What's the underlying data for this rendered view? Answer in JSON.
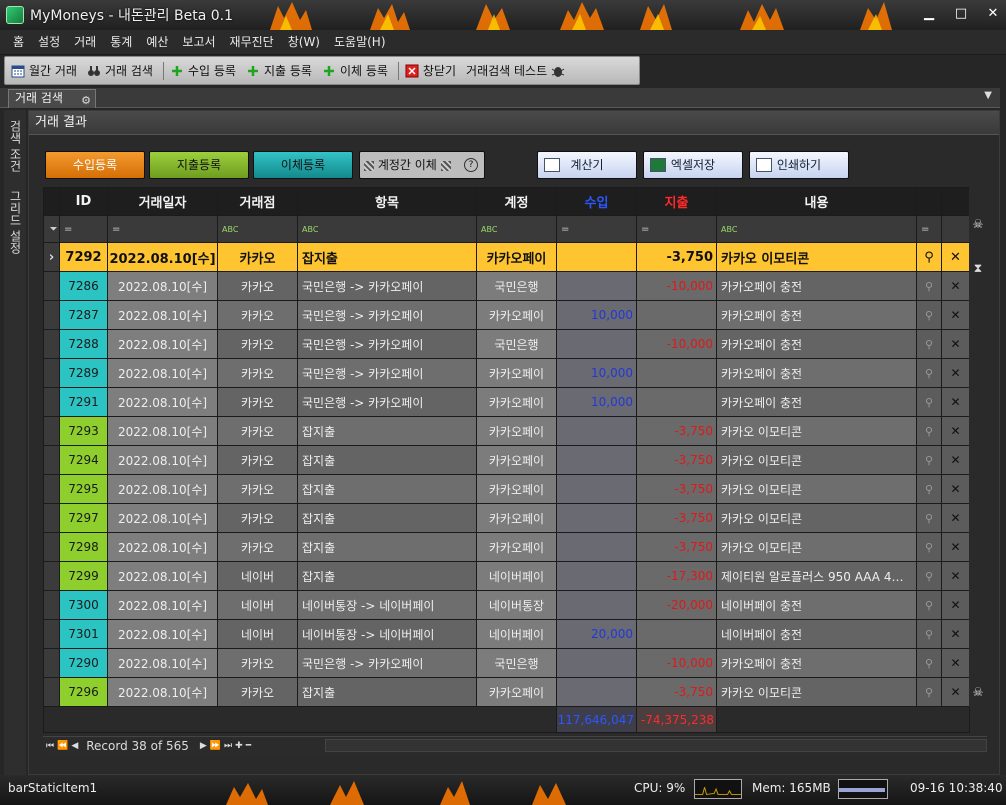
{
  "window": {
    "title": "MyMoneys - 내돈관리 Beta 0.1",
    "min": "▁",
    "max": "□",
    "close": "✕"
  },
  "menu": [
    "홈",
    "설정",
    "거래",
    "통계",
    "예산",
    "보고서",
    "재무진단",
    "창(W)",
    "도움말(H)"
  ],
  "toolbar": {
    "monthly": "월간 거래",
    "search": "거래 검색",
    "add_income": "수입 등록",
    "add_expense": "지출 등록",
    "add_transfer": "이체 등록",
    "close_window": "창닫기",
    "test": "거래검색 테스트"
  },
  "doc_tab": {
    "label": "거래 검색",
    "dropdown": "▼"
  },
  "side_tabs": [
    "검색 조건",
    "그리드 설정"
  ],
  "panel_title": "거래 결과",
  "buttons": {
    "income": "수입등록",
    "expense": "지출등록",
    "transfer": "이체등록",
    "between": "계정간 이체",
    "help": "?",
    "calc": "계산기",
    "excel": "엑셀저장",
    "print": "인쇄하기"
  },
  "columns": [
    "ID",
    "거래일자",
    "거래점",
    "항목",
    "계정",
    "수입",
    "지출",
    "내용"
  ],
  "rows": [
    {
      "id": "7292",
      "date": "2022.08.10[수]",
      "store": "카카오",
      "item": "잡지출",
      "acct": "카카오페이",
      "inc": "",
      "exp": "-3,750",
      "memo": "카카오 이모티콘",
      "color": "green",
      "current": true,
      "sel": "›"
    },
    {
      "id": "7286",
      "date": "2022.08.10[수]",
      "store": "카카오",
      "item": "국민은행 -> 카카오페이",
      "acct": "국민은행",
      "inc": "",
      "exp": "-10,000",
      "memo": "카카오페이 충전",
      "color": "blue"
    },
    {
      "id": "7287",
      "date": "2022.08.10[수]",
      "store": "카카오",
      "item": "국민은행 -> 카카오페이",
      "acct": "카카오페이",
      "inc": "10,000",
      "exp": "",
      "memo": "카카오페이 충전",
      "color": "blue"
    },
    {
      "id": "7288",
      "date": "2022.08.10[수]",
      "store": "카카오",
      "item": "국민은행 -> 카카오페이",
      "acct": "국민은행",
      "inc": "",
      "exp": "-10,000",
      "memo": "카카오페이 충전",
      "color": "blue"
    },
    {
      "id": "7289",
      "date": "2022.08.10[수]",
      "store": "카카오",
      "item": "국민은행 -> 카카오페이",
      "acct": "카카오페이",
      "inc": "10,000",
      "exp": "",
      "memo": "카카오페이 충전",
      "color": "blue"
    },
    {
      "id": "7291",
      "date": "2022.08.10[수]",
      "store": "카카오",
      "item": "국민은행 -> 카카오페이",
      "acct": "카카오페이",
      "inc": "10,000",
      "exp": "",
      "memo": "카카오페이 충전",
      "color": "blue"
    },
    {
      "id": "7293",
      "date": "2022.08.10[수]",
      "store": "카카오",
      "item": "잡지출",
      "acct": "카카오페이",
      "inc": "",
      "exp": "-3,750",
      "memo": "카카오 이모티콘",
      "color": "green"
    },
    {
      "id": "7294",
      "date": "2022.08.10[수]",
      "store": "카카오",
      "item": "잡지출",
      "acct": "카카오페이",
      "inc": "",
      "exp": "-3,750",
      "memo": "카카오 이모티콘",
      "color": "green"
    },
    {
      "id": "7295",
      "date": "2022.08.10[수]",
      "store": "카카오",
      "item": "잡지출",
      "acct": "카카오페이",
      "inc": "",
      "exp": "-3,750",
      "memo": "카카오 이모티콘",
      "color": "green"
    },
    {
      "id": "7297",
      "date": "2022.08.10[수]",
      "store": "카카오",
      "item": "잡지출",
      "acct": "카카오페이",
      "inc": "",
      "exp": "-3,750",
      "memo": "카카오 이모티콘",
      "color": "green"
    },
    {
      "id": "7298",
      "date": "2022.08.10[수]",
      "store": "카카오",
      "item": "잡지출",
      "acct": "카카오페이",
      "inc": "",
      "exp": "-3,750",
      "memo": "카카오 이모티콘",
      "color": "green"
    },
    {
      "id": "7299",
      "date": "2022.08.10[수]",
      "store": "네이버",
      "item": "잡지출",
      "acct": "네이버페이",
      "inc": "",
      "exp": "-17,300",
      "memo": "제이티원 알로플러스 950 AAA 4…",
      "color": "green"
    },
    {
      "id": "7300",
      "date": "2022.08.10[수]",
      "store": "네이버",
      "item": "네이버통장 -> 네이버페이",
      "acct": "네이버통장",
      "inc": "",
      "exp": "-20,000",
      "memo": "네이버페이 충전",
      "color": "blue"
    },
    {
      "id": "7301",
      "date": "2022.08.10[수]",
      "store": "네이버",
      "item": "네이버통장 -> 네이버페이",
      "acct": "네이버페이",
      "inc": "20,000",
      "exp": "",
      "memo": "네이버페이 충전",
      "color": "blue"
    },
    {
      "id": "7290",
      "date": "2022.08.10[수]",
      "store": "카카오",
      "item": "국민은행 -> 카카오페이",
      "acct": "국민은행",
      "inc": "",
      "exp": "-10,000",
      "memo": "카카오페이 충전",
      "color": "blue"
    },
    {
      "id": "7296",
      "date": "2022.08.10[수]",
      "store": "카카오",
      "item": "잡지출",
      "acct": "카카오페이",
      "inc": "",
      "exp": "-3,750",
      "memo": "카카오 이모티콘",
      "color": "green"
    }
  ],
  "totals": {
    "income": "117,646,047",
    "expense": "-74,375,238"
  },
  "navigator": {
    "record": "Record 38 of 565"
  },
  "status": {
    "item": "barStaticItem1",
    "cpu": "CPU: 9%",
    "mem": "Mem: 165MB",
    "mem_level": 0.95,
    "clock": "09-16 10:38:40"
  }
}
